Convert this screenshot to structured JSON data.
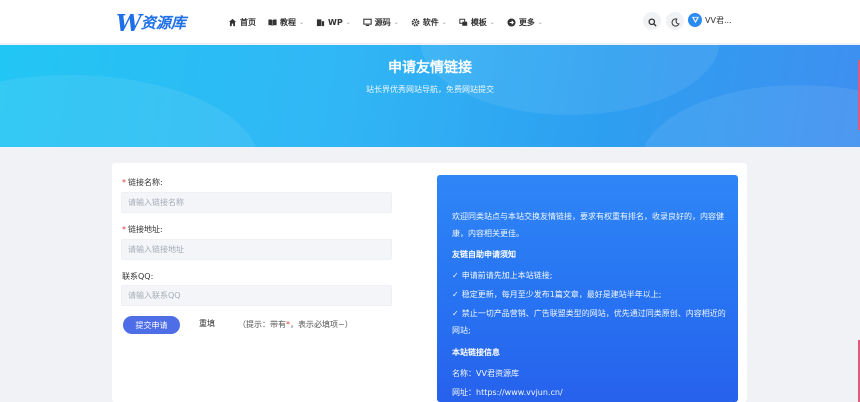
{
  "header": {
    "logo_mark": "W",
    "logo_text": "资源库",
    "nav": [
      {
        "label": "首页",
        "icon": "home-icon",
        "has_menu": false
      },
      {
        "label": "教程",
        "icon": "book-icon",
        "has_menu": true
      },
      {
        "label": "WP",
        "icon": "wordpress-icon",
        "has_menu": true
      },
      {
        "label": "源码",
        "icon": "monitor-icon",
        "has_menu": true
      },
      {
        "label": "软件",
        "icon": "gear-icon",
        "has_menu": true
      },
      {
        "label": "模板",
        "icon": "template-icon",
        "has_menu": true
      },
      {
        "label": "更多",
        "icon": "arrow-circle-icon",
        "has_menu": true
      }
    ],
    "chevron": "⌄",
    "user_name": "VV君..."
  },
  "banner": {
    "title": "申请友情链接",
    "subtitle": "站长界优秀网站导航，免费网站提交"
  },
  "form": {
    "required_mark": "*",
    "name_label": "链接名称:",
    "name_placeholder": "请输入链接名称",
    "url_label": "链接地址:",
    "url_placeholder": "请输入链接地址",
    "qq_label": "联系QQ:",
    "qq_placeholder": "请输入联系QQ",
    "submit_label": "提交申请",
    "reset_label": "重填",
    "hint_prefix": "（提示：带有",
    "hint_mark": "*",
    "hint_suffix": "，表示必填项~）"
  },
  "info": {
    "intro": "欢迎同类站点与本站交换友情链接，要求有权重有排名，收录良好的，内容健康，内容相关更佳。",
    "rules_title": "友链自助申请须知",
    "check_mark": "✓",
    "rules": [
      "申请前请先加上本站链接;",
      "稳定更新，每月至少发布1篇文章，最好是建站半年以上;",
      "禁止一切产品营销、广告联盟类型的网站，优先通过同类原创、内容相近的网站;"
    ],
    "site_title": "本站链接信息",
    "site_name": "名称：VV君资源库",
    "site_url": "网址：https://www.vvjun.cn/"
  },
  "colors": {
    "brand": "#1e6fe8",
    "banner_start": "#22c6f4",
    "banner_end": "#3f8ff0",
    "submit": "#4e6ee8",
    "required": "#e03b3b",
    "panel": "#2773f2"
  }
}
